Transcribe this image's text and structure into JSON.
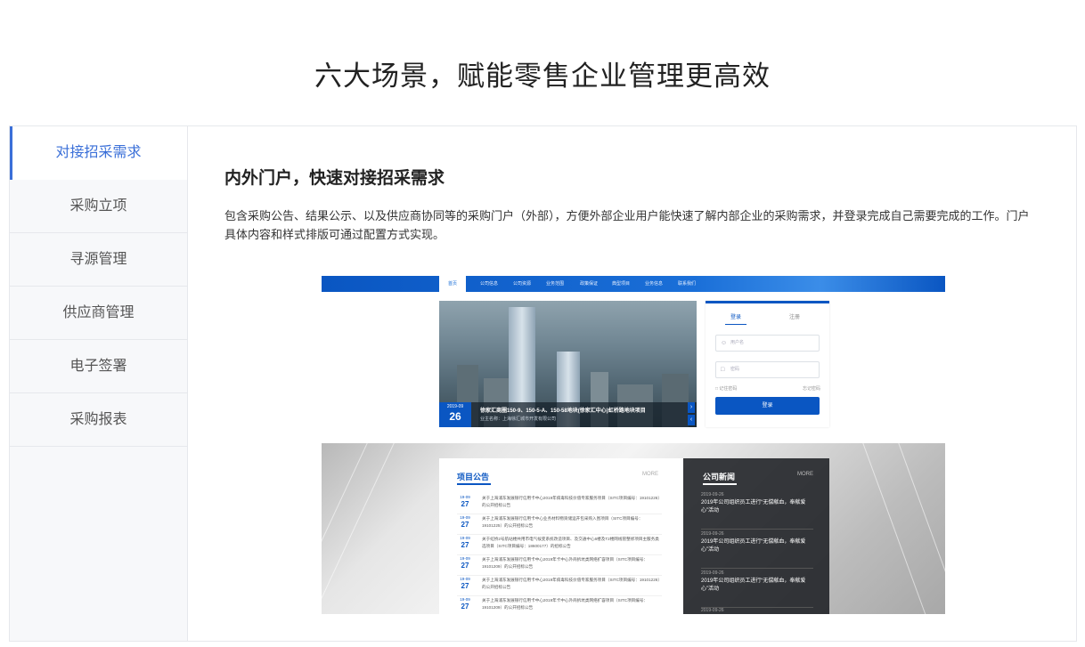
{
  "page": {
    "title": "六大场景，赋能零售企业管理更高效"
  },
  "sidebar": {
    "items": [
      {
        "label": "对接招采需求",
        "active": true
      },
      {
        "label": "采购立项",
        "active": false
      },
      {
        "label": "寻源管理",
        "active": false
      },
      {
        "label": "供应商管理",
        "active": false
      },
      {
        "label": "电子签署",
        "active": false
      },
      {
        "label": "采购报表",
        "active": false
      }
    ]
  },
  "content": {
    "title": "内外门户，快速对接招采需求",
    "description": "包含采购公告、结果公示、以及供应商协同等的采购门户（外部），方便外部企业用户能快速了解内部企业的采购需求，并登录完成自己需要完成的工作。门户具体内容和样式排版可通过配置方式实现。"
  },
  "mock": {
    "nav": [
      "首页",
      "公司信息",
      "公司资源",
      "业务范围",
      "政策保证",
      "典型项目",
      "业务信息",
      "联系我们"
    ],
    "hero": {
      "date_ym": "2019-09",
      "date_day": "26",
      "caption": "徐家汇商圈150-9、150-5-A、150-58地块(徐家汇中心)虹桥路地块项目",
      "subcaption": "业主名称：上海徐汇城市开发有限公司",
      "arrow_next": "›",
      "arrow_prev": "‹"
    },
    "login": {
      "tab_login": "登录",
      "tab_register": "注册",
      "username_placeholder": "用户名",
      "password_placeholder": "密码",
      "remember": "记住密码",
      "forgot": "忘记密码",
      "button": "登录",
      "user_icon": "user-icon",
      "lock_icon": "lock-icon"
    },
    "notices": {
      "title": "项目公告",
      "more": "MORE",
      "rows": [
        {
          "ym": "19-09",
          "day": "27",
          "text": "关于上海浦东发展银行信用卡中心2019年病毒科技价值专家服务项目（SITC项目编号：19101226）的公开招标公告"
        },
        {
          "ym": "19-09",
          "day": "27",
          "text": "关于上海浦东发展银行信用卡中心业务材料物资储运开包采购入围项目（SITC项目编号：19101225）的公开招标公告"
        },
        {
          "ym": "19-09",
          "day": "27",
          "text": "关于虹桥2号航站楼共用市电气候变系统改造项目、及交通中心6楼及T2楼网线管整修项目主服务类选项目（SITC项目编号：18600177）的招标公告"
        },
        {
          "ym": "19-09",
          "day": "27",
          "text": "关于上海浦东发展银行信用卡中心2019年卡中心外商拆坑类网络扩容项目（SITC项目编号：19101209）的公开招标公告"
        },
        {
          "ym": "19-09",
          "day": "27",
          "text": "关于上海浦东发展银行信用卡中心2019年病毒科技价值专家服务项目（SITC项目编号：19101226）的公开招标公告"
        },
        {
          "ym": "19-09",
          "day": "27",
          "text": "关于上海浦东发展银行信用卡中心2019年卡中心外商拆坑类网络扩容项目（SITC项目编号：19101209）的公开招标公告"
        }
      ]
    },
    "news": {
      "title": "公司新闻",
      "more": "MORE",
      "rows": [
        {
          "date": "2019-09-26",
          "text": "2019年公司组织员工进行“无偿献血，奉献爱心”活动"
        },
        {
          "date": "2019-09-26",
          "text": "2019年公司组织员工进行“无偿献血，奉献爱心”活动"
        },
        {
          "date": "2019-09-26",
          "text": "2019年公司组织员工进行“无偿献血，奉献爱心”活动"
        },
        {
          "date": "2019-09-26",
          "text": ""
        }
      ]
    }
  }
}
